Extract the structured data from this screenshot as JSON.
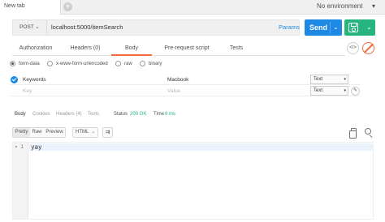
{
  "tabs": [
    {
      "label": "New tab"
    }
  ],
  "tab_add_label": "+",
  "environment": {
    "selected": "No environment",
    "caret": "▾"
  },
  "request": {
    "method": "POST",
    "method_caret": "⌄",
    "url": "localhost:5000/itemSearch",
    "params_label": "Params",
    "send_label": "Send",
    "caret": "⌄"
  },
  "request_tabs": [
    "Authorization",
    "Headers (0)",
    "Body",
    "Pre-request script",
    "Tests"
  ],
  "active_request_tab": "Body",
  "code_button_label": "</>",
  "body_types": [
    {
      "label": "form-data",
      "checked": true
    },
    {
      "label": "x-www-form-urlencoded",
      "checked": false
    },
    {
      "label": "raw",
      "checked": false
    },
    {
      "label": "binary",
      "checked": false
    }
  ],
  "form_rows": [
    {
      "key": "Keywords",
      "value": "Macbook",
      "type": "Text",
      "enabled": true
    },
    {
      "key_placeholder": "Key",
      "value_placeholder": "Value",
      "type": "Text",
      "enabled": false
    }
  ],
  "dropdown_caret": "▾",
  "edit_label": "✎",
  "response": {
    "tabs": [
      "Body",
      "Cookies",
      "Headers (4)",
      "Tests"
    ],
    "active_tab": "Body",
    "status_label": "Status",
    "status_value": "200 OK",
    "time_label": "Time",
    "time_value": "8 ms",
    "view_modes": [
      "Pretty",
      "Raw",
      "Preview"
    ],
    "active_view_mode": "Pretty",
    "format": "HTML",
    "format_caret": "⌄",
    "wrap_label": "⇉",
    "lines": [
      {
        "number": "1",
        "fold": "▾",
        "text": "yay"
      }
    ]
  },
  "colors": {
    "accent_blue": "#1e88e5",
    "save_green": "#26b47f",
    "active_orange": "#f26b3a"
  }
}
